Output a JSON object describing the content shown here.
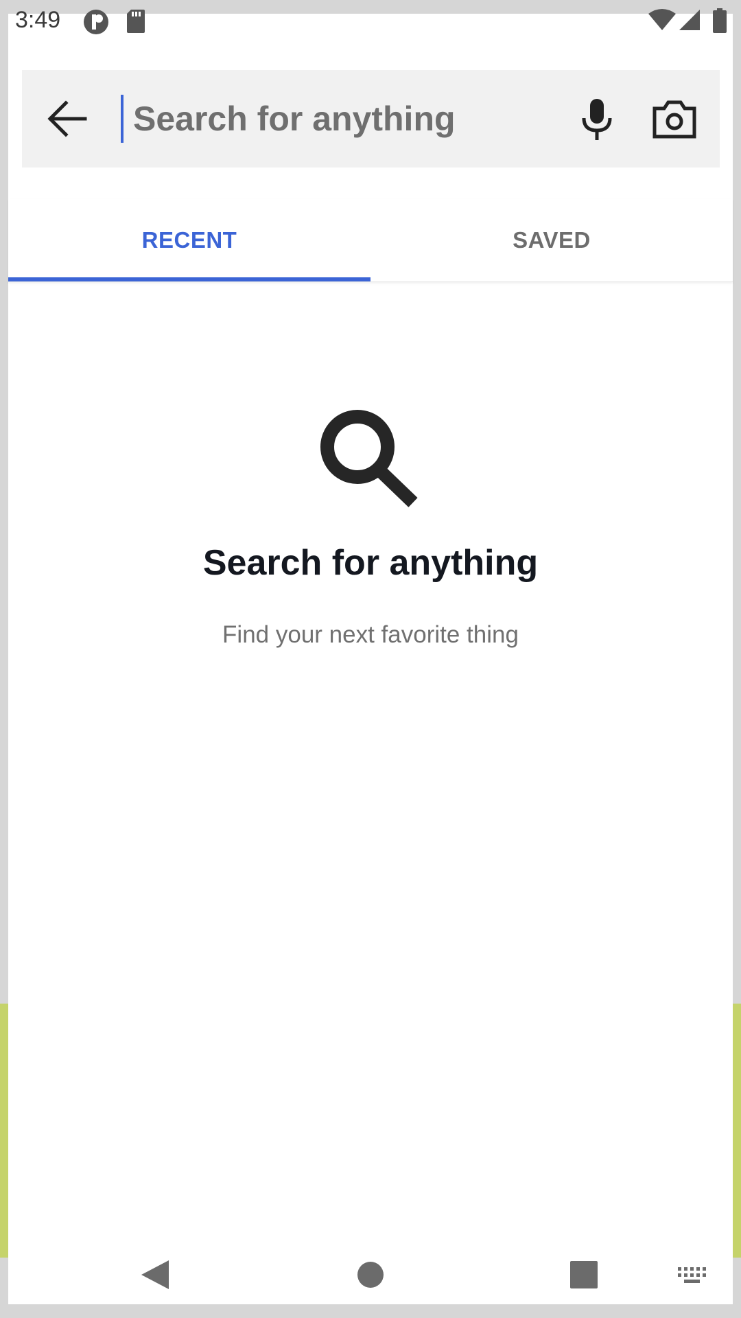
{
  "status_bar": {
    "time": "3:49",
    "icons": [
      "app-notification-icon",
      "sd-card-icon",
      "wifi-icon",
      "cell-signal-icon",
      "battery-icon"
    ]
  },
  "search": {
    "placeholder": "Search for anything",
    "value": "",
    "back_icon": "arrow-back-icon",
    "mic_icon": "microphone-icon",
    "camera_icon": "camera-icon"
  },
  "tabs": [
    {
      "label": "RECENT",
      "active": true
    },
    {
      "label": "SAVED",
      "active": false
    }
  ],
  "empty_state": {
    "icon": "magnifier-icon",
    "title": "Search for anything",
    "subtitle": "Find your next favorite thing"
  },
  "nav_bar": {
    "icons": [
      "nav-back-icon",
      "nav-home-icon",
      "nav-recents-icon",
      "keyboard-icon"
    ]
  },
  "colors": {
    "accent": "#3b64d6",
    "search_bg": "#f1f1f1",
    "title": "#141820",
    "subtitle": "#707070"
  }
}
